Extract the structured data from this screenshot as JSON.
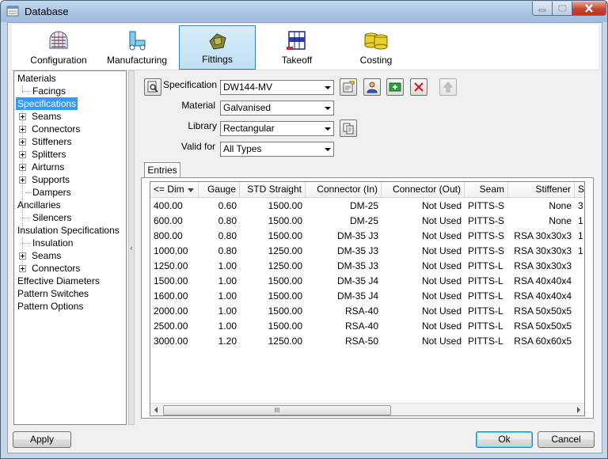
{
  "window": {
    "title": "Database"
  },
  "toolbar": {
    "items": [
      {
        "label": "Configuration",
        "icon": "configuration-icon"
      },
      {
        "label": "Manufacturing",
        "icon": "manufacturing-icon"
      },
      {
        "label": "Fittings",
        "icon": "fittings-icon",
        "active": true
      },
      {
        "label": "Takeoff",
        "icon": "takeoff-icon"
      },
      {
        "label": "Costing",
        "icon": "costing-icon"
      }
    ]
  },
  "tree": {
    "materials": "Materials",
    "facings": "Facings",
    "specifications": "Specifications",
    "seams": "Seams",
    "connectors": "Connectors",
    "stiffeners": "Stiffeners",
    "splitters": "Splitters",
    "airturns": "Airturns",
    "supports": "Supports",
    "dampers": "Dampers",
    "ancillaries": "Ancillaries",
    "silencers": "Silencers",
    "insulation_specifications": "Insulation Specifications",
    "insulation": "Insulation",
    "ins_seams": "Seams",
    "ins_connectors": "Connectors",
    "effective_diameters": "Effective Diameters",
    "pattern_switches": "Pattern Switches",
    "pattern_options": "Pattern Options"
  },
  "form": {
    "specification_label": "Specification",
    "specification_value": "DW144-MV",
    "material_label": "Material",
    "material_value": "Galvanised",
    "library_label": "Library",
    "library_value": "Rectangular",
    "valid_for_label": "Valid for",
    "valid_for_value": "All Types"
  },
  "tab": {
    "label": "Entries"
  },
  "grid": {
    "columns": [
      "<= Dim",
      "Gauge",
      "STD Straight",
      "Connector (In)",
      "Connector (Out)",
      "Seam",
      "Stiffener",
      "S"
    ],
    "rows": [
      [
        "400.00",
        "0.60",
        "1500.00",
        "DM-25",
        "Not Used",
        "PITTS-S",
        "None",
        "3"
      ],
      [
        "600.00",
        "0.80",
        "1500.00",
        "DM-25",
        "Not Used",
        "PITTS-S",
        "None",
        "1"
      ],
      [
        "800.00",
        "0.80",
        "1500.00",
        "DM-35 J3",
        "Not Used",
        "PITTS-S",
        "RSA 30x30x3",
        "1"
      ],
      [
        "1000.00",
        "0.80",
        "1250.00",
        "DM-35 J3",
        "Not Used",
        "PITTS-S",
        "RSA 30x30x3",
        "1"
      ],
      [
        "1250.00",
        "1.00",
        "1250.00",
        "DM-35 J3",
        "Not Used",
        "PITTS-L",
        "RSA 30x30x3",
        ""
      ],
      [
        "1500.00",
        "1.00",
        "1500.00",
        "DM-35 J4",
        "Not Used",
        "PITTS-L",
        "RSA 40x40x4",
        ""
      ],
      [
        "1600.00",
        "1.00",
        "1500.00",
        "DM-35 J4",
        "Not Used",
        "PITTS-L",
        "RSA 40x40x4",
        ""
      ],
      [
        "2000.00",
        "1.00",
        "1500.00",
        "RSA-40",
        "Not Used",
        "PITTS-L",
        "RSA 50x50x5",
        ""
      ],
      [
        "2500.00",
        "1.00",
        "1500.00",
        "RSA-40",
        "Not Used",
        "PITTS-L",
        "RSA 50x50x5",
        ""
      ],
      [
        "3000.00",
        "1.20",
        "1250.00",
        "RSA-50",
        "Not Used",
        "PITTS-L",
        "RSA 60x60x5",
        ""
      ]
    ]
  },
  "buttons": {
    "apply": "Apply",
    "ok": "Ok",
    "cancel": "Cancel"
  }
}
